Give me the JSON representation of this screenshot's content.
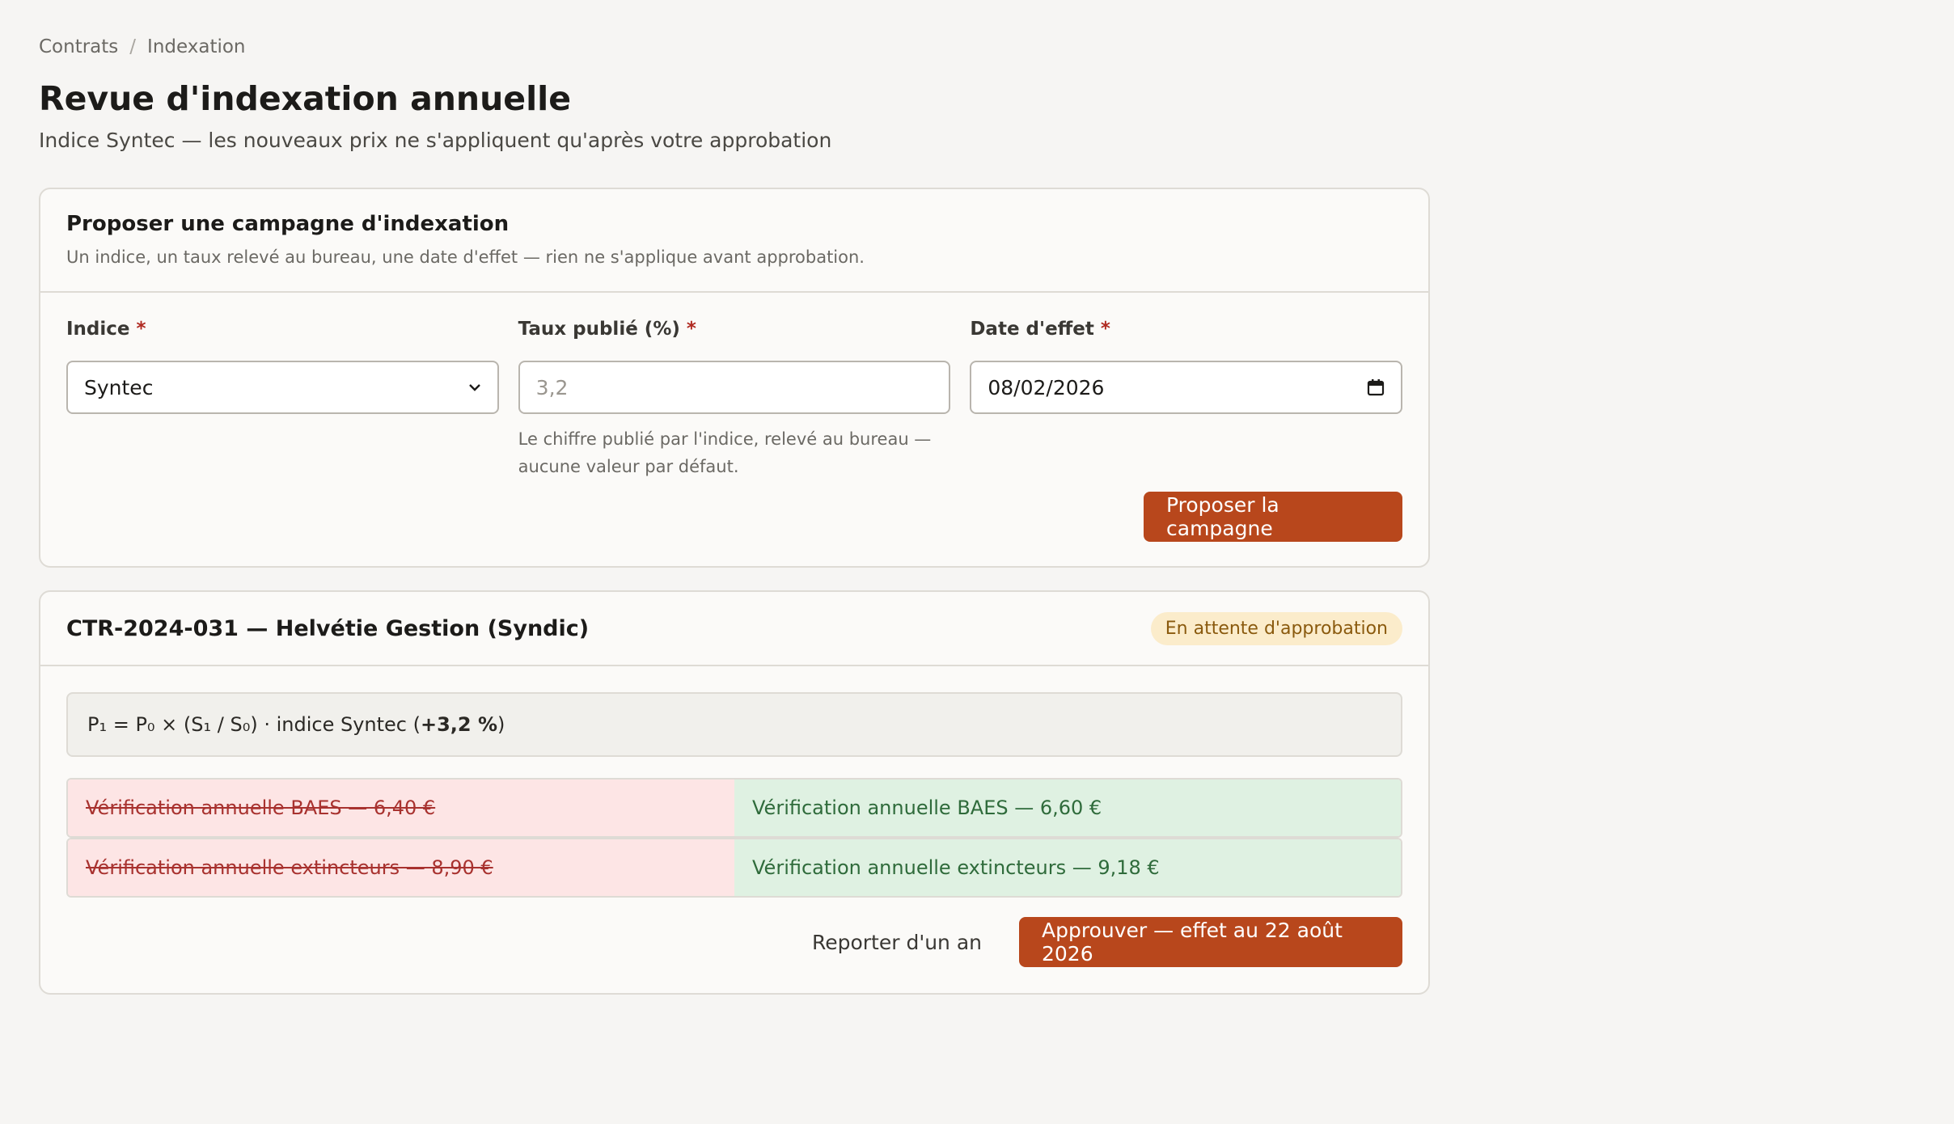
{
  "breadcrumb": {
    "items": [
      "Contrats",
      "Indexation"
    ],
    "separator": "/"
  },
  "header": {
    "title": "Revue d'indexation annuelle",
    "subtitle": "Indice Syntec — les nouveaux prix ne s'appliquent qu'après votre approbation"
  },
  "proposal": {
    "title": "Proposer une campagne d'indexation",
    "description": "Un indice, un taux relevé au bureau, une date d'effet — rien ne s'applique avant approbation.",
    "fields": {
      "index": {
        "label": "Indice",
        "required_mark": "*",
        "value": "Syntec"
      },
      "rate": {
        "label": "Taux publié (%)",
        "required_mark": "*",
        "value": "",
        "placeholder": "3,2",
        "hint": "Le chiffre publié par l'indice, relevé au bureau — aucune valeur par défaut."
      },
      "date": {
        "label": "Date d'effet",
        "required_mark": "*",
        "value": "08/02/2026"
      }
    },
    "submit_label": "Proposer la campagne"
  },
  "contract": {
    "title": "CTR-2024-031 — Helvétie Gestion (Syndic)",
    "status": "En attente d'approbation",
    "formula_prefix": "P₁ = P₀ × (S₁ / S₀) · indice Syntec (",
    "formula_rate": "+3,2 %",
    "formula_suffix": ")",
    "lines": [
      {
        "old": "Vérification annuelle BAES — 6,40 €",
        "new": "Vérification annuelle BAES — 6,60 €"
      },
      {
        "old": "Vérification annuelle extincteurs — 8,90 €",
        "new": "Vérification annuelle extincteurs — 9,18 €"
      }
    ],
    "postpone_label": "Reporter d'un an",
    "approve_label": "Approuver — effet au 22 août 2026"
  },
  "colors": {
    "accent": "#b8471c",
    "status_bg": "#fbeccb",
    "diff_old_bg": "#fde5e5",
    "diff_new_bg": "#dff1e2"
  },
  "icons": {
    "select": "chevron-down-icon",
    "date": "calendar-icon"
  }
}
